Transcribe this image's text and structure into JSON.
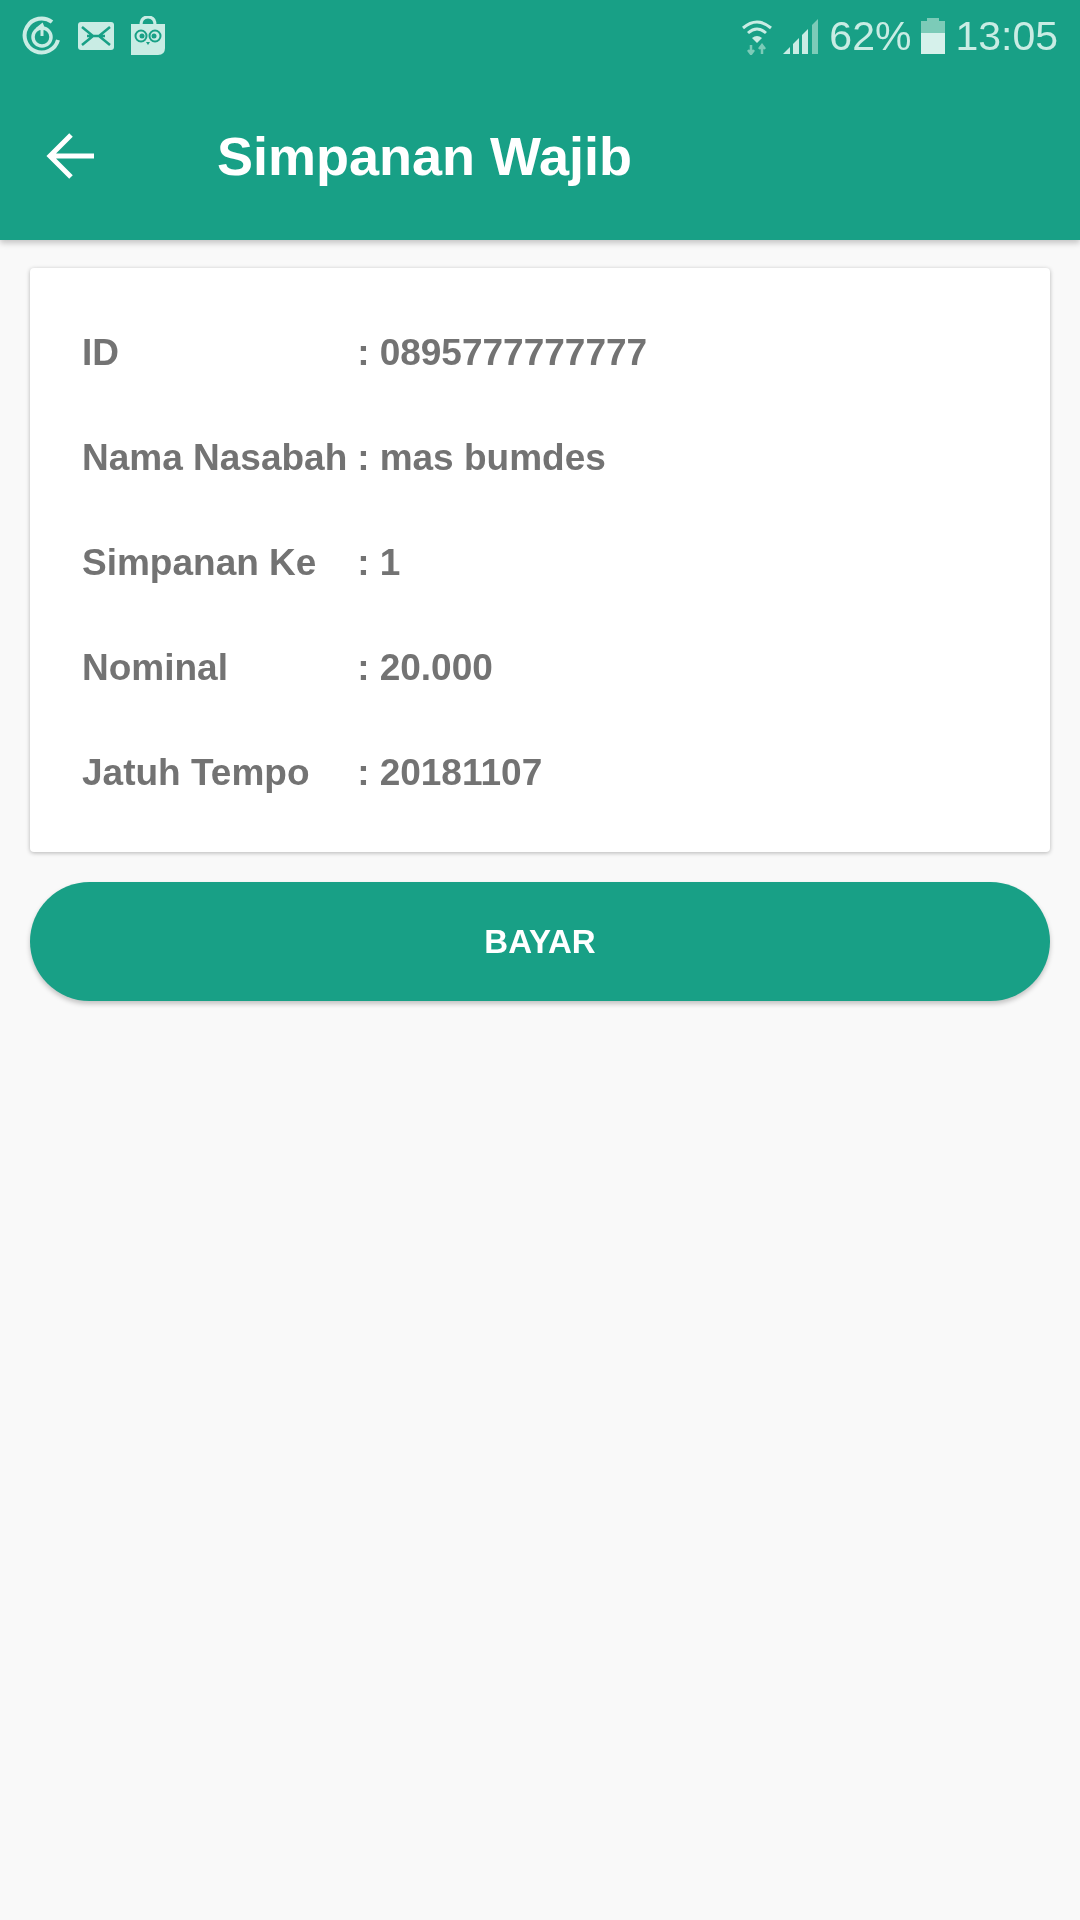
{
  "status_bar": {
    "battery_percent": "62%",
    "time": "13:05"
  },
  "app_bar": {
    "title": "Simpanan Wajib"
  },
  "details": [
    {
      "label": "ID",
      "separator": ":",
      "value": "0895777777777"
    },
    {
      "label": "Nama Nasabah",
      "separator": ":",
      "value": "mas bumdes"
    },
    {
      "label": "Simpanan Ke",
      "separator": ":",
      "value": "1"
    },
    {
      "label": "Nominal",
      "separator": ":",
      "value": "20.000"
    },
    {
      "label": "Jatuh Tempo",
      "separator": ":",
      "value": "20181107"
    }
  ],
  "pay_button": {
    "label": "BAYAR"
  }
}
